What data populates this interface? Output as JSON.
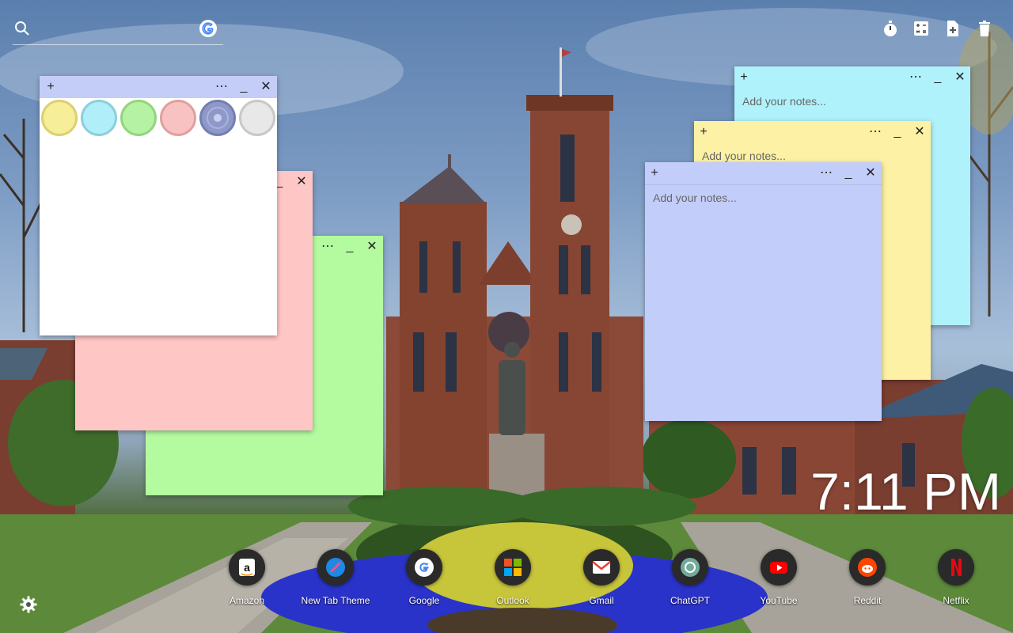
{
  "search": {
    "placeholder": ""
  },
  "top_tools": [
    {
      "name": "timer"
    },
    {
      "name": "calculator"
    },
    {
      "name": "new-note"
    },
    {
      "name": "trash"
    }
  ],
  "note_placeholder": "Add your notes...",
  "notes": {
    "color_picker": {
      "bg": "#ffffff",
      "bar": "#c4cdf7"
    },
    "pink": {
      "bg": "#ffc6c6"
    },
    "green": {
      "bg": "#b4fba0"
    },
    "cyan": {
      "bg": "#b0f2fb"
    },
    "yellow": {
      "bg": "#fdf1a5"
    },
    "lavender": {
      "bg": "#c3cdfa"
    }
  },
  "swatches": [
    "#f7ee9a",
    "#b0eefa",
    "#b6f2a3",
    "#f8c2c2",
    "#8e99c9",
    "#e8e8e8"
  ],
  "clock": {
    "time": "7:11 PM"
  },
  "apps": [
    {
      "label": "Amazon"
    },
    {
      "label": "New Tab Theme"
    },
    {
      "label": "Google"
    },
    {
      "label": "Outlook"
    },
    {
      "label": "Gmail"
    },
    {
      "label": "ChatGPT"
    },
    {
      "label": "YouTube"
    },
    {
      "label": "Reddit"
    },
    {
      "label": "Netflix"
    }
  ]
}
